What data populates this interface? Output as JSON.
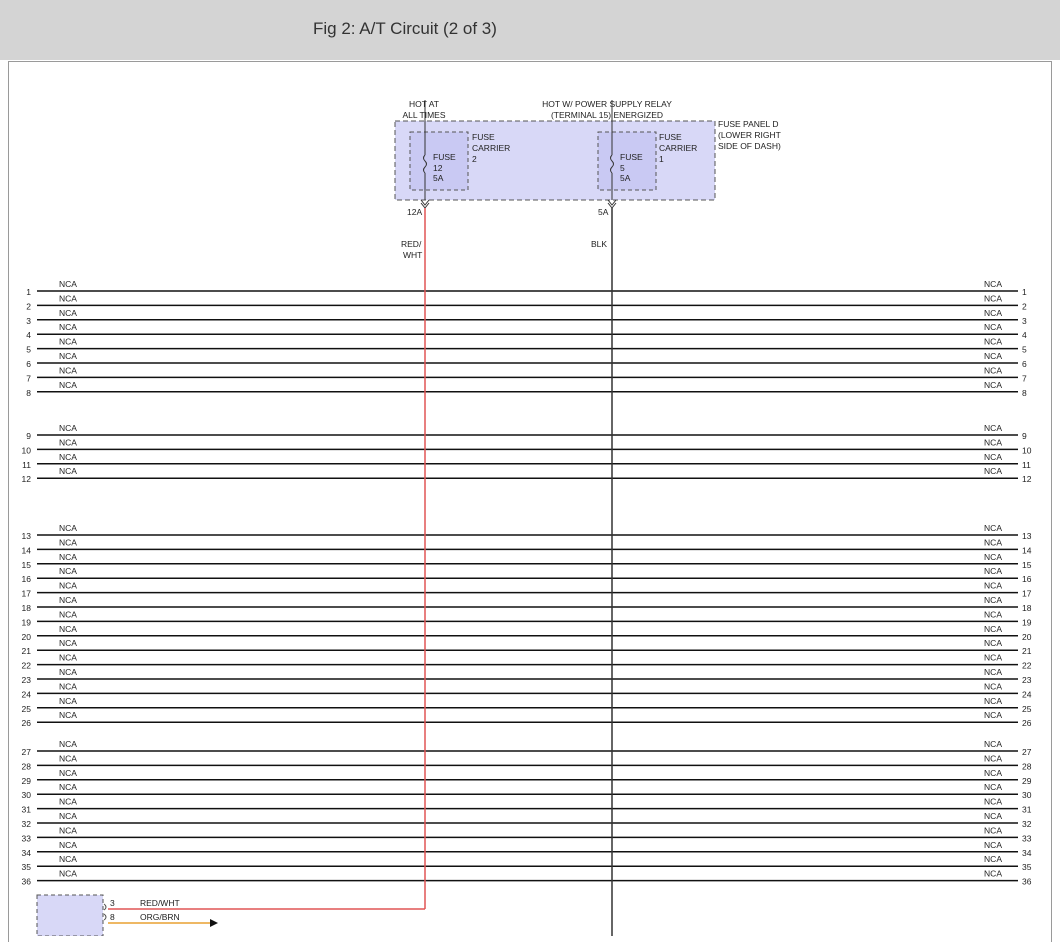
{
  "header": {
    "title": "Fig 2: A/T Circuit (2 of 3)"
  },
  "fuse_panel": {
    "label_lines": [
      "FUSE PANEL D",
      "(LOWER RIGHT",
      "SIDE OF DASH)"
    ],
    "supply_left_lines": [
      "HOT AT",
      "ALL TIMES"
    ],
    "supply_right_lines": [
      "HOT W/ POWER SUPPLY RELAY",
      "(TERMINAL 15) ENERGIZED"
    ],
    "carrier_left": {
      "label_lines": [
        "FUSE",
        "CARRIER",
        "2"
      ],
      "fuse_lines": [
        "FUSE",
        "12",
        "5A"
      ],
      "terminal": "12A"
    },
    "carrier_right": {
      "label_lines": [
        "FUSE",
        "CARRIER",
        "1"
      ],
      "fuse_lines": [
        "FUSE",
        "5",
        "5A"
      ],
      "terminal": "5A"
    }
  },
  "wires": {
    "left_color_lines": [
      "RED/",
      "WHT"
    ],
    "right_color": "BLK",
    "colors": {
      "red_wht": "#e05555",
      "blk": "#333333",
      "org_brn": "#e8a030"
    }
  },
  "connector_rows": {
    "nca_label": "NCA",
    "pins": [
      "1",
      "2",
      "3",
      "4",
      "5",
      "6",
      "7",
      "8",
      "9",
      "10",
      "11",
      "12",
      "13",
      "14",
      "15",
      "16",
      "17",
      "18",
      "19",
      "20",
      "21",
      "22",
      "23",
      "24",
      "25",
      "26",
      "27",
      "28",
      "29",
      "30",
      "31",
      "32",
      "33",
      "34",
      "35",
      "36"
    ]
  },
  "bottom_connector": {
    "pins": [
      {
        "pin": "3",
        "wire": "RED/WHT"
      },
      {
        "pin": "8",
        "wire": "ORG/BRN"
      }
    ]
  }
}
